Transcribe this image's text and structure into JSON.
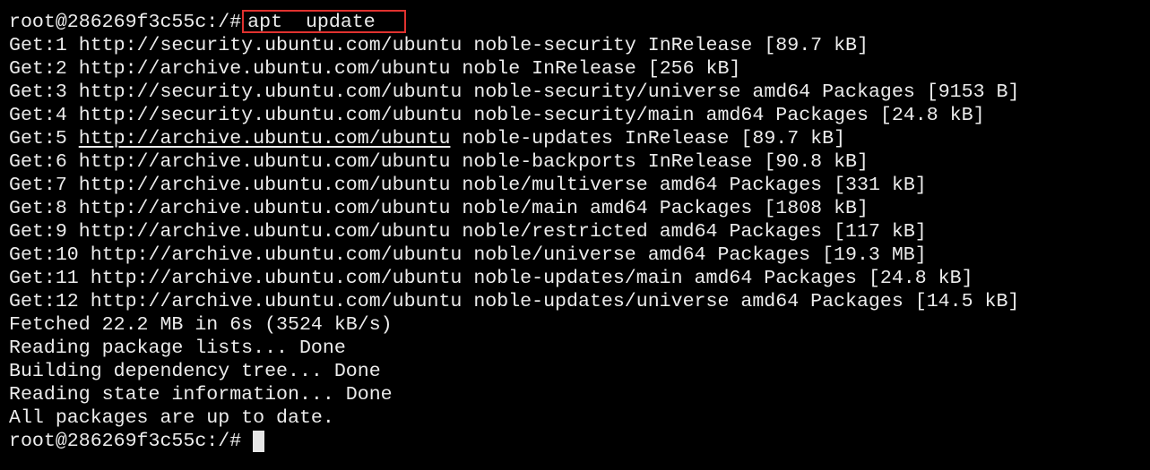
{
  "terminal": {
    "prompt": "root@286269f3c55c:/#",
    "command": "apt  update",
    "get_lines": [
      {
        "prefix": "Get:1 ",
        "url": "http://security.ubuntu.com/ubuntu",
        "rest": " noble-security InRelease [89.7 kB]",
        "underlined": false
      },
      {
        "prefix": "Get:2 ",
        "url": "http://archive.ubuntu.com/ubuntu",
        "rest": " noble InRelease [256 kB]",
        "underlined": false
      },
      {
        "prefix": "Get:3 ",
        "url": "http://security.ubuntu.com/ubuntu",
        "rest": " noble-security/universe amd64 Packages [9153 B]",
        "underlined": false
      },
      {
        "prefix": "Get:4 ",
        "url": "http://security.ubuntu.com/ubuntu",
        "rest": " noble-security/main amd64 Packages [24.8 kB]",
        "underlined": false
      },
      {
        "prefix": "Get:5 ",
        "url": "http://archive.ubuntu.com/ubuntu",
        "rest": " noble-updates InRelease [89.7 kB]",
        "underlined": true
      },
      {
        "prefix": "Get:6 ",
        "url": "http://archive.ubuntu.com/ubuntu",
        "rest": " noble-backports InRelease [90.8 kB]",
        "underlined": false
      },
      {
        "prefix": "Get:7 ",
        "url": "http://archive.ubuntu.com/ubuntu",
        "rest": " noble/multiverse amd64 Packages [331 kB]",
        "underlined": false
      },
      {
        "prefix": "Get:8 ",
        "url": "http://archive.ubuntu.com/ubuntu",
        "rest": " noble/main amd64 Packages [1808 kB]",
        "underlined": false
      },
      {
        "prefix": "Get:9 ",
        "url": "http://archive.ubuntu.com/ubuntu",
        "rest": " noble/restricted amd64 Packages [117 kB]",
        "underlined": false
      },
      {
        "prefix": "Get:10 ",
        "url": "http://archive.ubuntu.com/ubuntu",
        "rest": " noble/universe amd64 Packages [19.3 MB]",
        "underlined": false
      },
      {
        "prefix": "Get:11 ",
        "url": "http://archive.ubuntu.com/ubuntu",
        "rest": " noble-updates/main amd64 Packages [24.8 kB]",
        "underlined": false
      },
      {
        "prefix": "Get:12 ",
        "url": "http://archive.ubuntu.com/ubuntu",
        "rest": " noble-updates/universe amd64 Packages [14.5 kB]",
        "underlined": false
      }
    ],
    "summary_lines": [
      "Fetched 22.2 MB in 6s (3524 kB/s)",
      "Reading package lists... Done",
      "Building dependency tree... Done",
      "Reading state information... Done",
      "All packages are up to date."
    ],
    "final_prompt": "root@286269f3c55c:/#",
    "colors": {
      "background": "#000000",
      "text": "#ececec",
      "highlight_border": "#e0322f",
      "cursor": "#e6e6e6"
    }
  }
}
